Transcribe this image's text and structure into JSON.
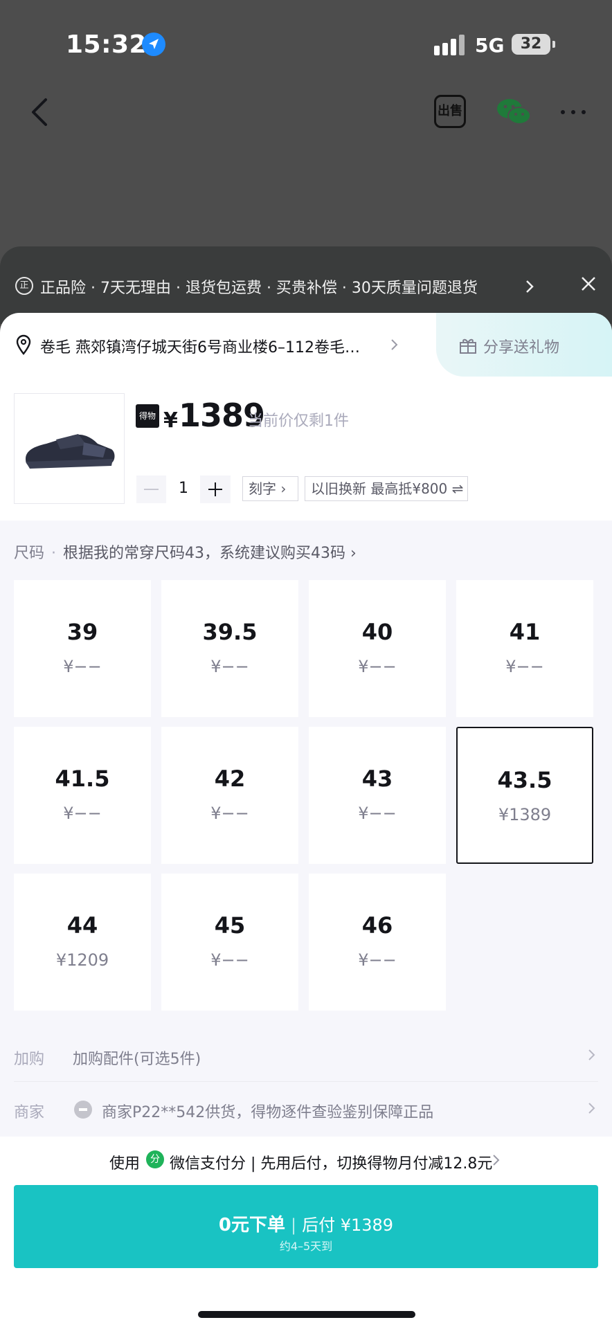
{
  "status_bar": {
    "time": "15:32",
    "network": "5G",
    "battery": "32"
  },
  "nav": {
    "sell_label": "出售"
  },
  "guarantee": {
    "icon_text": "正",
    "text": "正品险 · 7天无理由 · 退货包运费 · 买贵补偿 · 30天质量问题退货"
  },
  "address": {
    "text": "卷毛  燕郊镇湾仔城天街6号商业楼6–112卷毛…"
  },
  "share": {
    "label": "分享送礼物"
  },
  "product": {
    "brand_logo": "得物",
    "currency": "¥",
    "price": "1389",
    "price_note": "当前价仅剩1件",
    "quantity": "1",
    "engrave_label": "刻字 ›",
    "tradein_label": "以旧换新  最高抵¥800 ⇌"
  },
  "size_section": {
    "label": "尺码",
    "hint": "根据我的常穿尺码43，系统建议购买43码 ›",
    "selected": "43.5",
    "sizes": [
      {
        "size": "39",
        "price": "¥−−"
      },
      {
        "size": "39.5",
        "price": "¥−−"
      },
      {
        "size": "40",
        "price": "¥−−"
      },
      {
        "size": "41",
        "price": "¥−−"
      },
      {
        "size": "41.5",
        "price": "¥−−"
      },
      {
        "size": "42",
        "price": "¥−−"
      },
      {
        "size": "43",
        "price": "¥−−"
      },
      {
        "size": "43.5",
        "price": "¥1389"
      },
      {
        "size": "44",
        "price": "¥1209"
      },
      {
        "size": "45",
        "price": "¥−−"
      },
      {
        "size": "46",
        "price": "¥−−"
      }
    ]
  },
  "addon": {
    "label": "加购",
    "text": "加购配件(可选5件)"
  },
  "merchant": {
    "label": "商家",
    "text": "商家P22**542供货，得物逐件查验鉴别保障正品"
  },
  "payment": {
    "prefix": "使用",
    "icon_text": "分",
    "text": "微信支付分 | 先用后付，切换得物月付减12.8元"
  },
  "order_button": {
    "main": "0元下单",
    "separator": "|",
    "after": "后付 ¥1389",
    "sub": "约4–5天到"
  },
  "colors": {
    "accent": "#19c3c3",
    "selected_border": "#14151a",
    "overlay": "#4d4d4d"
  }
}
